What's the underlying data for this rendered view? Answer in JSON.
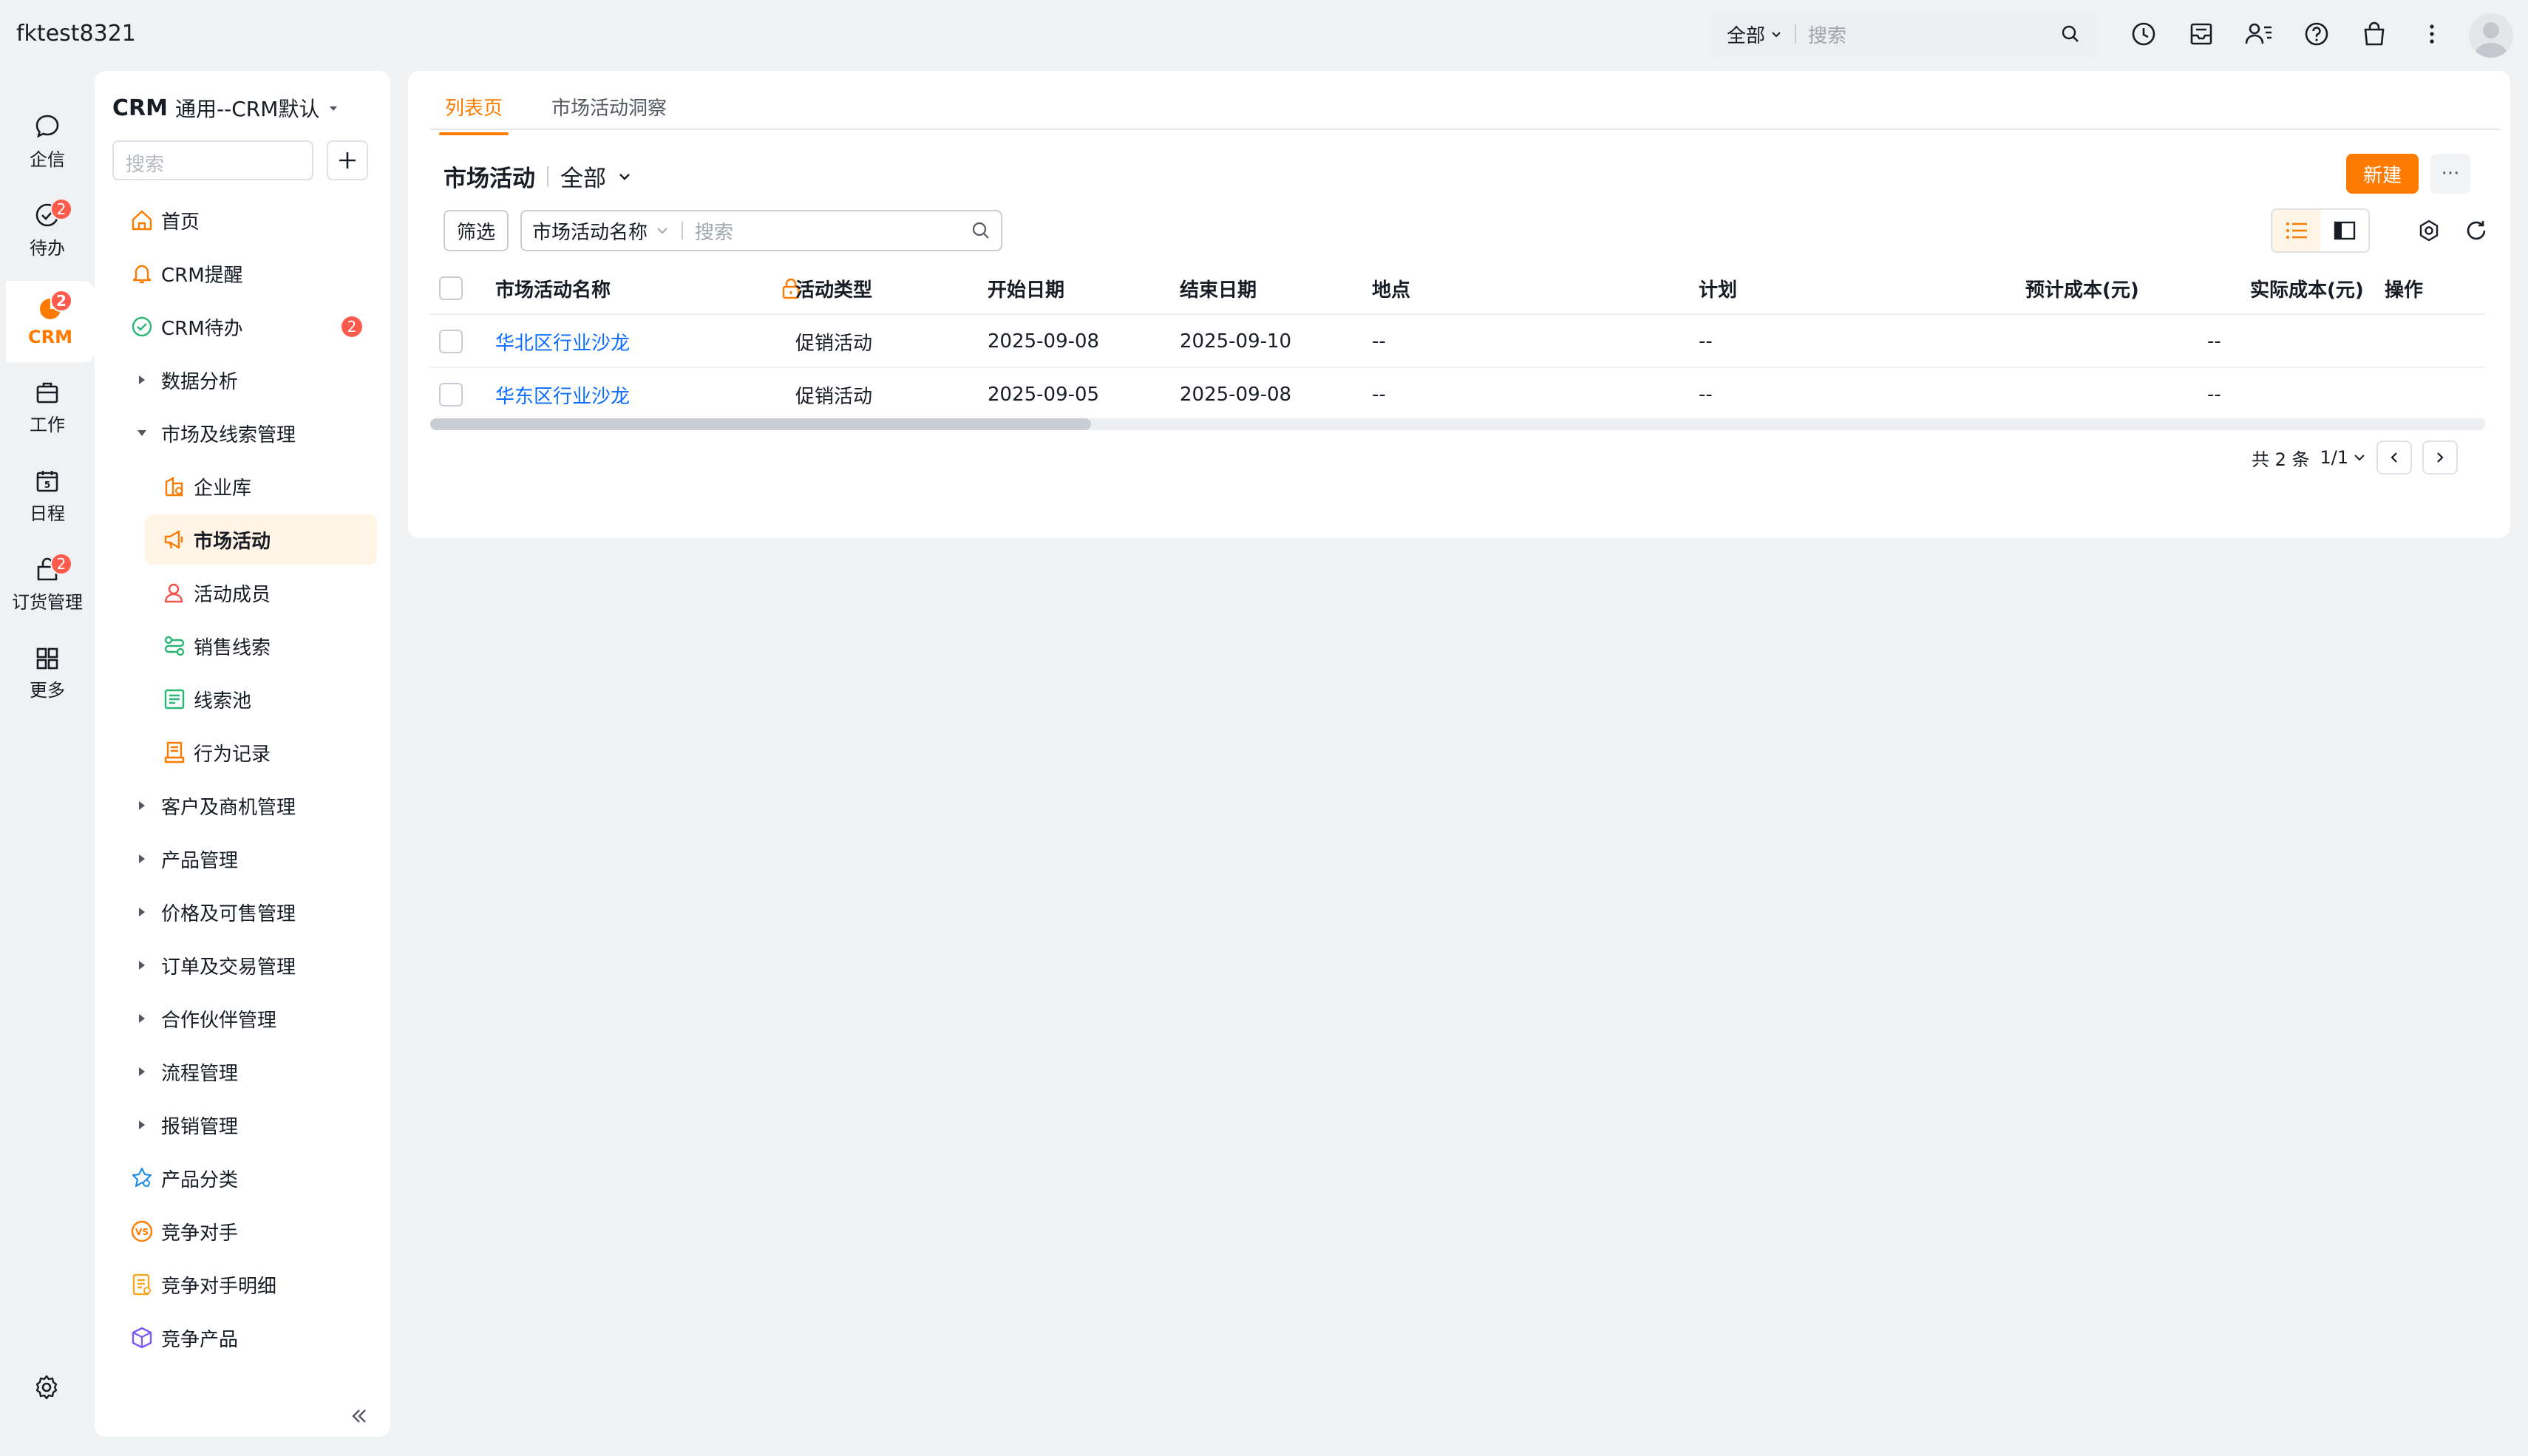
{
  "app": {
    "company": "fktest8321"
  },
  "global_search": {
    "scope": "全部",
    "placeholder": "搜索"
  },
  "top_icons": [
    "clock-icon",
    "inbox-icon",
    "contacts-icon",
    "help-icon",
    "bag-icon",
    "more-vertical-icon"
  ],
  "rail": [
    {
      "label": "企信",
      "icon": "chat-icon",
      "badge": ""
    },
    {
      "label": "待办",
      "icon": "todo-icon",
      "badge": "2"
    },
    {
      "label": "CRM",
      "icon": "crm-icon",
      "badge": "2",
      "active": true
    },
    {
      "label": "工作",
      "icon": "work-icon",
      "badge": ""
    },
    {
      "label": "日程",
      "icon": "calendar-icon",
      "badge": ""
    },
    {
      "label": "订货管理",
      "icon": "order-icon",
      "badge": "2"
    },
    {
      "label": "更多",
      "icon": "grid-icon",
      "badge": ""
    }
  ],
  "nav": {
    "app": "CRM",
    "workspace": "通用--CRM默认",
    "search_placeholder": "搜索",
    "items": [
      {
        "label": "首页",
        "icon": "home-icon"
      },
      {
        "label": "CRM提醒",
        "icon": "bell-icon"
      },
      {
        "label": "CRM待办",
        "icon": "check-circle-icon",
        "badge": "2"
      },
      {
        "label": "数据分析",
        "caret": "right"
      },
      {
        "label": "市场及线索管理",
        "caret": "down"
      },
      {
        "label": "企业库",
        "icon": "building-icon",
        "sub": true
      },
      {
        "label": "市场活动",
        "icon": "megaphone-icon",
        "sub": true,
        "active": true
      },
      {
        "label": "活动成员",
        "icon": "person-icon",
        "sub": true
      },
      {
        "label": "销售线索",
        "icon": "lead-icon",
        "sub": true
      },
      {
        "label": "线索池",
        "icon": "pool-icon",
        "sub": true
      },
      {
        "label": "行为记录",
        "icon": "record-icon",
        "sub": true
      },
      {
        "label": "客户及商机管理",
        "caret": "right"
      },
      {
        "label": "产品管理",
        "caret": "right"
      },
      {
        "label": "价格及可售管理",
        "caret": "right"
      },
      {
        "label": "订单及交易管理",
        "caret": "right"
      },
      {
        "label": "合作伙伴管理",
        "caret": "right"
      },
      {
        "label": "流程管理",
        "caret": "right"
      },
      {
        "label": "报销管理",
        "caret": "right"
      },
      {
        "label": "产品分类",
        "icon": "category-icon"
      },
      {
        "label": "竞争对手",
        "icon": "vs-icon"
      },
      {
        "label": "竞争对手明细",
        "icon": "detail-icon"
      },
      {
        "label": "竞争产品",
        "icon": "box-icon"
      }
    ]
  },
  "main": {
    "tabs": [
      "列表页",
      "市场活动洞察"
    ],
    "list_title": "市场活动",
    "list_scope": "全部",
    "new_button": "新建",
    "more_button": "···",
    "filter_button": "筛选",
    "search_field": "市场活动名称",
    "search_placeholder": "搜索",
    "columns": [
      "市场活动名称",
      "活动类型",
      "开始日期",
      "结束日期",
      "地点",
      "计划",
      "预计成本(元)",
      "实际成本(元)",
      "操作"
    ],
    "rows": [
      [
        "华北区行业沙龙",
        "促销活动",
        "2025-09-08",
        "2025-09-10",
        "--",
        "--",
        "--"
      ],
      [
        "华东区行业沙龙",
        "促销活动",
        "2025-09-05",
        "2025-09-08",
        "--",
        "--",
        "--"
      ]
    ],
    "pager": {
      "total": "共 2 条",
      "page": "1/1"
    }
  },
  "colors": {
    "accent": "#ff7a00",
    "link": "#0c6cff",
    "badge": "#ff5b4c"
  }
}
